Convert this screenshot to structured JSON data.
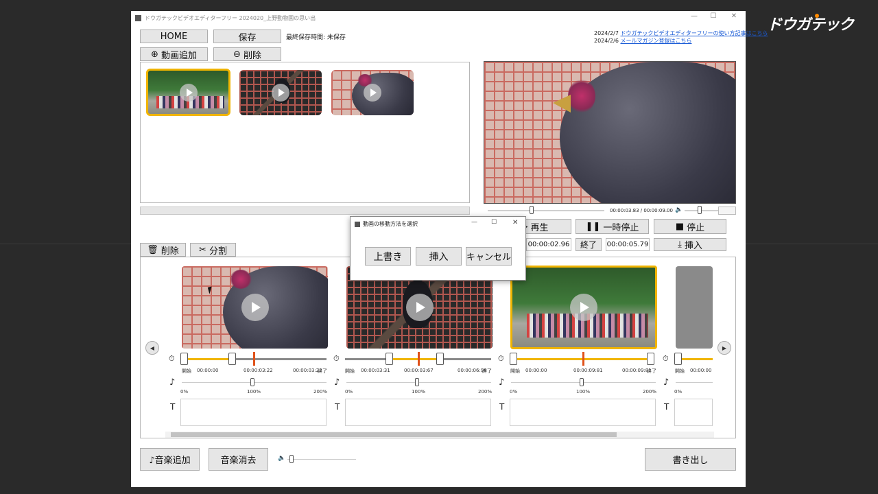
{
  "brand": {
    "logo_text": "ドウガテック"
  },
  "window": {
    "title": "ドウガテックビデオエディターフリー 2024020_上野動物園の思い出",
    "minimize": "—",
    "maximize": "☐",
    "close": "✕"
  },
  "toolbar": {
    "home_label": "HOME",
    "save_label": "保存",
    "last_saved": "最終保存時間: 未保存",
    "add_video_label": "動画追加",
    "delete_label": "削除"
  },
  "news": [
    {
      "date": "2024/2/7",
      "text": "ドウガテックビデオエディターフリーの使い方記事はこちら"
    },
    {
      "date": "2024/2/6",
      "text": "メールマガジン登録はこちら"
    }
  ],
  "preview": {
    "time": "00:00:03.83 / 00:00:09.00",
    "volume_icon": "speaker-icon"
  },
  "playback": {
    "play_label": "再生",
    "pause_label": "一時停止",
    "stop_label": "停止",
    "start_time": "00:00:02.96",
    "end_label": "終了",
    "end_time": "00:00:05.79",
    "insert_label": "挿入"
  },
  "timeline_toolbar": {
    "delete_label": "削除",
    "split_label": "分割"
  },
  "clips": [
    {
      "start_label": "開始",
      "start": "00:00:00",
      "mid": "00:00:03:22",
      "end": "00:00:03:22",
      "end_label": "終了",
      "vol_min": "0%",
      "vol_mid": "100%",
      "vol_max": "200%"
    },
    {
      "start_label": "開始",
      "start": "00:00:03:31",
      "mid": "00:00:03:67",
      "end": "00:00:06:98",
      "end_label": "終了",
      "vol_min": "0%",
      "vol_mid": "100%",
      "vol_max": "200%"
    },
    {
      "start_label": "開始",
      "start": "00:00:00",
      "mid": "00:00:09:81",
      "end": "00:00:09:81",
      "end_label": "終了",
      "vol_min": "0%",
      "vol_mid": "100%",
      "vol_max": "200%"
    },
    {
      "start_label": "開始",
      "start": "00:00:00",
      "mid": "",
      "end": "",
      "end_label": "",
      "vol_min": "0%",
      "vol_mid": "",
      "vol_max": ""
    }
  ],
  "dialog": {
    "title": "動画の移動方法を選択",
    "overwrite_label": "上書き",
    "insert_label": "挿入",
    "cancel_label": "キャンセル"
  },
  "bottom": {
    "add_music_label": "♪音楽追加",
    "remove_music_label": "音楽消去",
    "export_label": "書き出し"
  },
  "colors": {
    "accent": "#f0b400",
    "marker": "#e0521a",
    "link": "#1a5bd6"
  }
}
